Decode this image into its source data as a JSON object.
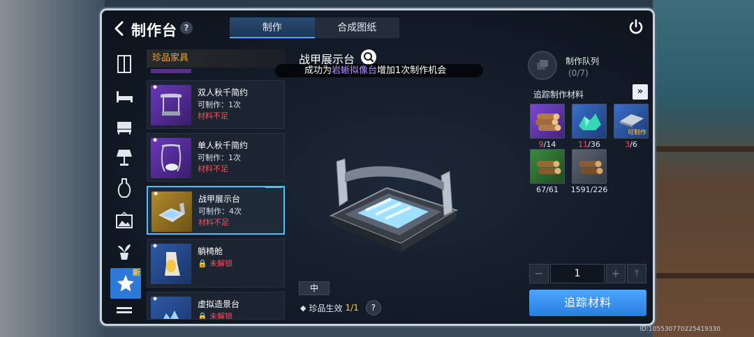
{
  "header": {
    "title": "制作台",
    "help": "?",
    "tabs": [
      {
        "label": "制作",
        "active": true
      },
      {
        "label": "合成图纸",
        "active": false
      }
    ]
  },
  "sidebar": {
    "categories": [
      "cabinet-icon",
      "bed-icon",
      "sofa-icon",
      "lamp-icon",
      "vase-icon",
      "picture-icon",
      "plant-icon",
      "star-icon",
      "table-icon"
    ],
    "active_index": 7,
    "new_badge": "新"
  },
  "list": {
    "header": "珍品家具",
    "items": [
      {
        "name": "双人秋千简约",
        "count": "可制作：1次",
        "status": "材料不足",
        "locked": false,
        "rarity": "purple",
        "selected": false
      },
      {
        "name": "单人秋千简约",
        "count": "可制作：1次",
        "status": "材料不足",
        "locked": false,
        "rarity": "purple",
        "selected": false
      },
      {
        "name": "战甲展示台",
        "count": "可制作：4次",
        "status": "材料不足",
        "locked": false,
        "rarity": "gold",
        "selected": true
      },
      {
        "name": "躺椅舱",
        "count": "",
        "status": "未解锁",
        "locked": true,
        "rarity": "blue",
        "selected": false
      },
      {
        "name": "虚拟造景台",
        "count": "",
        "status": "未解锁",
        "locked": true,
        "rarity": "blue",
        "selected": false
      }
    ]
  },
  "detail": {
    "title": "战甲展示台",
    "toast_prefix": "成功为",
    "toast_highlight": "岩蜥拟像台",
    "toast_suffix": "增加1次制作机会",
    "size": "中",
    "effect_label": "珍品生效",
    "effect_value": "1/1",
    "effect_help": "?"
  },
  "queue": {
    "label": "制作队列",
    "count": "(0/7)"
  },
  "materials": {
    "label": "追踪制作材料",
    "expand": "»",
    "items": [
      {
        "icon": "log-bundle-icon",
        "rarity": "purple",
        "have": "9",
        "need": "14",
        "short": true,
        "craftable": false
      },
      {
        "icon": "crystal-icon",
        "rarity": "blue",
        "have": "11",
        "need": "36",
        "short": true,
        "craftable": false
      },
      {
        "icon": "metal-plate-icon",
        "rarity": "blue",
        "have": "3",
        "need": "6",
        "short": true,
        "craftable": true,
        "craftable_label": "可制作"
      },
      {
        "icon": "log-icon",
        "rarity": "green",
        "have": "67",
        "need": "61",
        "short": false,
        "craftable": false
      },
      {
        "icon": "log-icon",
        "rarity": "gray",
        "have": "1591",
        "need": "226",
        "short": false,
        "craftable": false
      }
    ]
  },
  "quantity": {
    "minus": "−",
    "value": "1",
    "plus": "+",
    "max": "⤒"
  },
  "track_button": "追踪材料",
  "uid": "ID:105530770225419330"
}
